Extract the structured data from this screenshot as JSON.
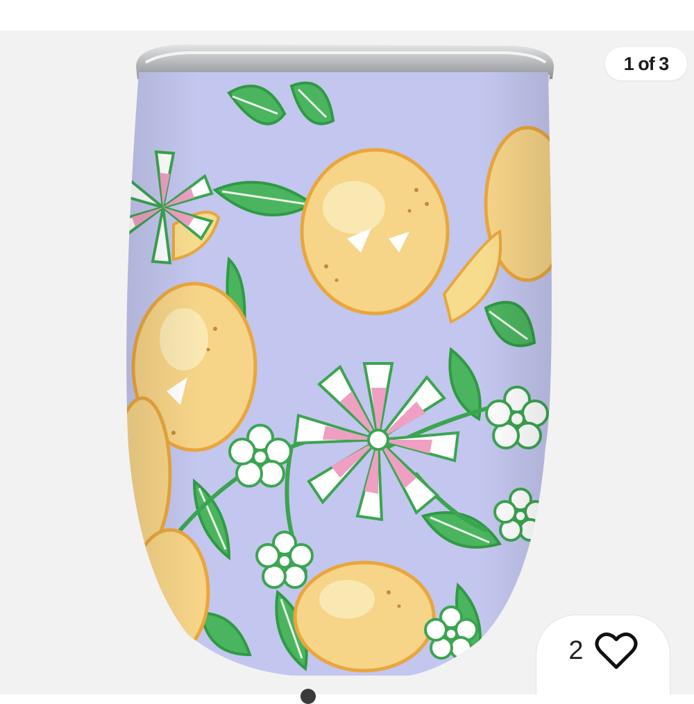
{
  "gallery": {
    "counter": "1 of 3",
    "product_image_icon": "insulated-tumbler-lemon-floral-print-photo"
  },
  "like": {
    "count": "2",
    "icon": "heart-outline-icon"
  },
  "colors": {
    "gallery_background": "#f2f2f2",
    "tumbler_lavender": "#c3c6ee",
    "lemon_yellow": "#f6d488",
    "leaf_green": "#3fae55",
    "petal_pink": "#ee9fc2",
    "lid_silver": "#c9cacc"
  }
}
